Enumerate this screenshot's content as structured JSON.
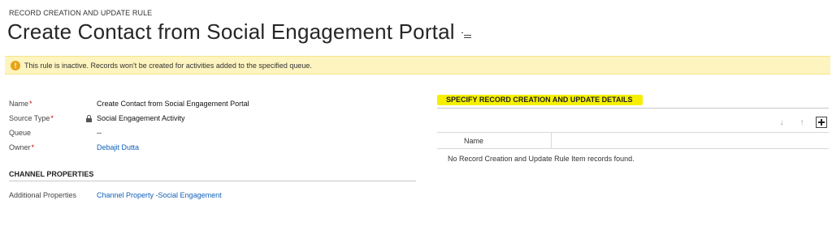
{
  "header": {
    "entity_type": "RECORD CREATION AND UPDATE RULE",
    "title": "Create Contact from Social Engagement Portal"
  },
  "notification": {
    "text": "This rule is inactive. Records won't be created for activities added to the specified queue.",
    "icon": "warning-icon"
  },
  "fields": {
    "name": {
      "label": "Name",
      "required": "*",
      "value": "Create Contact from Social Engagement Portal"
    },
    "source_type": {
      "label": "Source Type",
      "required": "*",
      "value": "Social Engagement Activity"
    },
    "queue": {
      "label": "Queue",
      "value": "--"
    },
    "owner": {
      "label": "Owner",
      "required": "*",
      "value": "Debajit Dutta"
    }
  },
  "channel_properties": {
    "heading": "CHANNEL PROPERTIES",
    "additional_properties": {
      "label": "Additional Properties",
      "value": "Channel Property -Social Engagement"
    }
  },
  "details": {
    "heading": "SPECIFY RECORD CREATION AND UPDATE DETAILS",
    "grid": {
      "columns": [
        "Name"
      ],
      "empty_message": "No Record Creation and Update Rule Item records found."
    }
  },
  "colors": {
    "link": "#1160b7",
    "required": "#cc0000",
    "notification_bg": "#fdf4bf",
    "highlight": "#f6f000"
  }
}
